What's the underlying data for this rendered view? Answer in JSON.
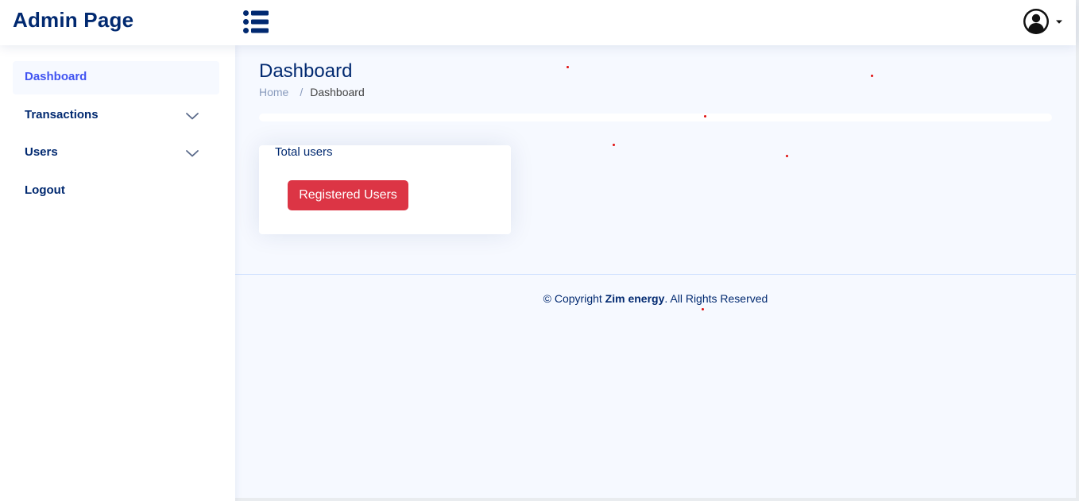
{
  "app": {
    "brand": "Admin Page"
  },
  "header": {
    "menu_icon": "list-icon",
    "profile_icon": "user-circle-icon",
    "profile_caret_icon": "caret-down-icon"
  },
  "sidebar": {
    "items": [
      {
        "label": "Dashboard",
        "active": true,
        "expandable": false
      },
      {
        "label": "Transactions",
        "active": false,
        "expandable": true
      },
      {
        "label": "Users",
        "active": false,
        "expandable": true
      },
      {
        "label": "Logout",
        "active": false,
        "expandable": false
      }
    ]
  },
  "main": {
    "page_title": "Dashboard",
    "breadcrumb": {
      "home": "Home",
      "separator": "/",
      "current": "Dashboard"
    },
    "progress": {
      "value_percent": 0
    },
    "card": {
      "title": "Total users",
      "button_label": "Registered Users"
    }
  },
  "footer": {
    "prefix": "© Copyright ",
    "company": "Zim energy",
    "suffix": ". All Rights Reserved"
  },
  "colors": {
    "brand_navy": "#012970",
    "active_blue": "#4154f1",
    "danger": "#dc3545",
    "page_background": "#f6f9ff"
  }
}
